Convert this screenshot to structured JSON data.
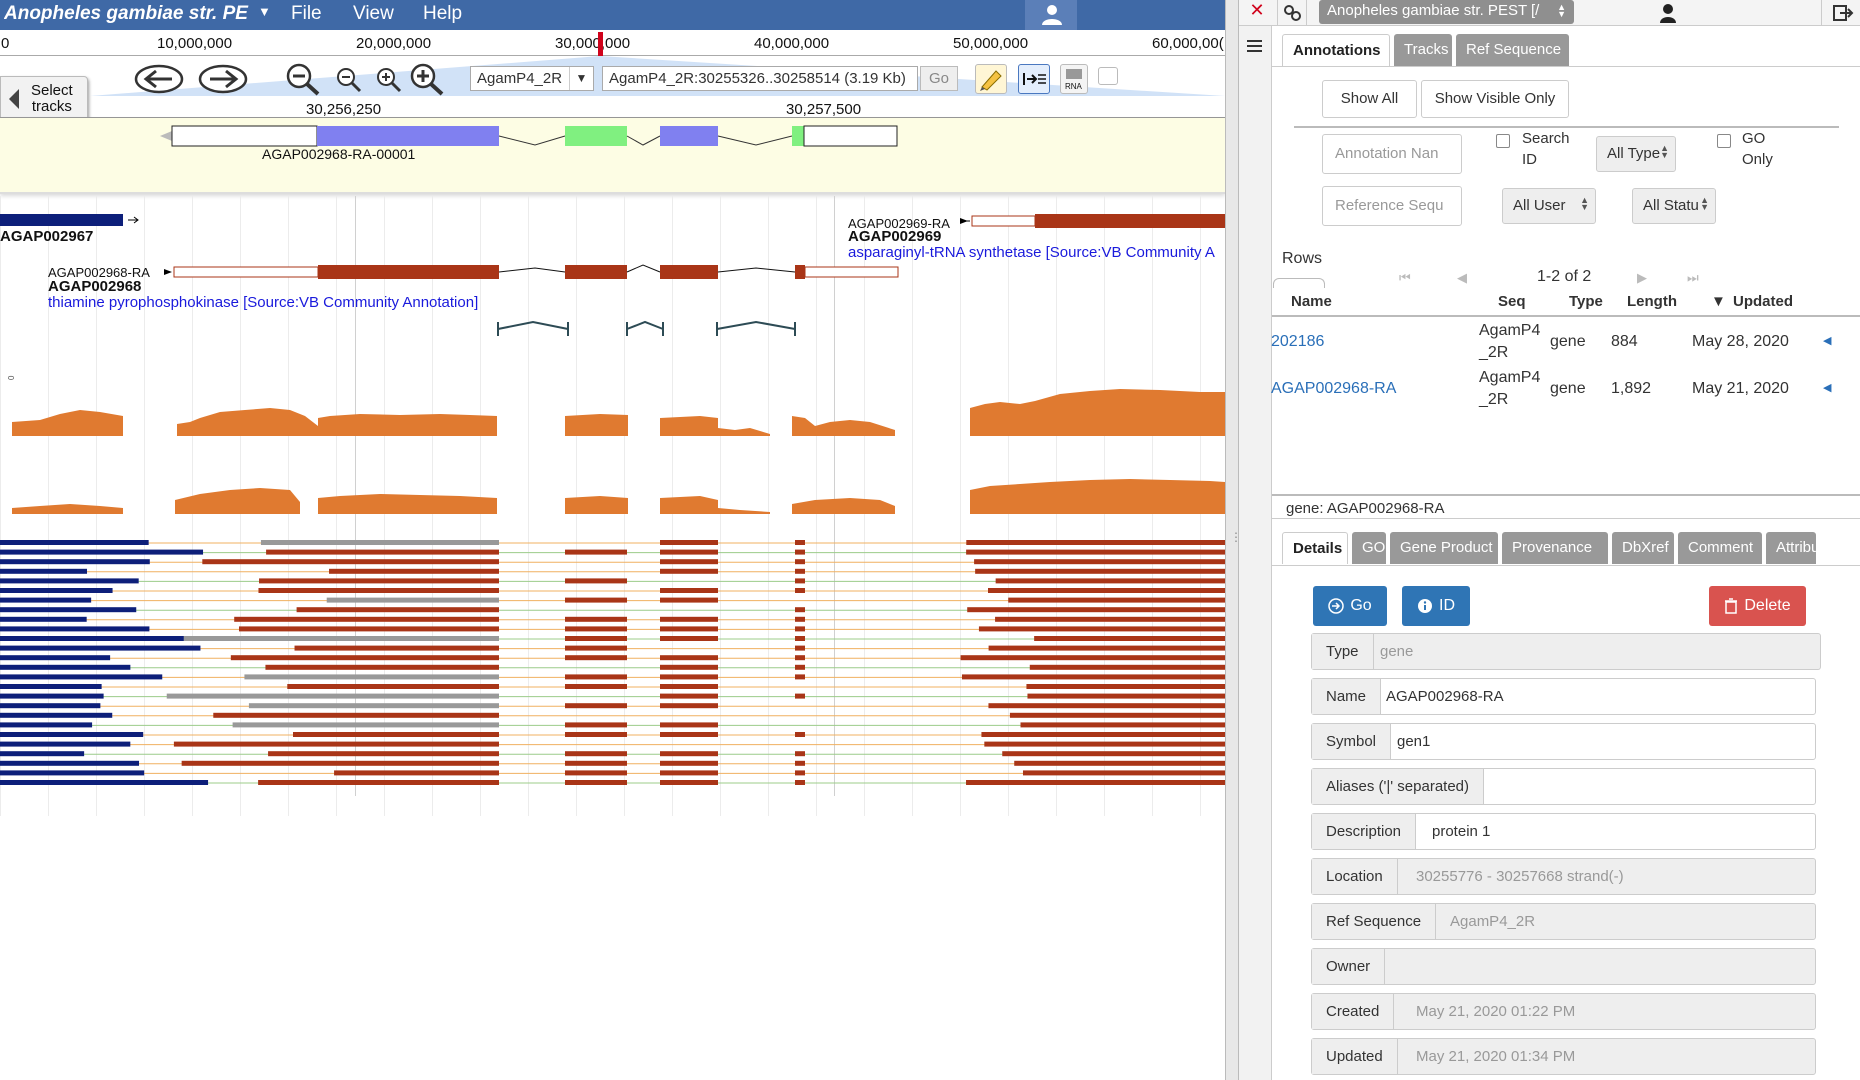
{
  "browser": {
    "organism": "Anopheles gambiae str. PE",
    "menus": [
      "File",
      "View",
      "Help"
    ],
    "overview_ticks": [
      "0",
      "10,000,000",
      "20,000,000",
      "30,000,000",
      "40,000,000",
      "50,000,000",
      "60,000,00("
    ],
    "ruler_ticks": [
      "30,256,250",
      "30,257,500"
    ],
    "refseq": "AgamP4_2R",
    "location": "AgamP4_2R:30255326..30258514 (3.19 Kb)",
    "go_label": "Go",
    "select_tracks": [
      "Select",
      "tracks"
    ],
    "user_annotation": "AGAP002968-RA-00001",
    "genes": [
      {
        "transcript": "AGAP002969-RA",
        "name": "AGAP002969",
        "description": "asparaginyl-tRNA synthetase [Source:VB Community A"
      },
      {
        "transcript": "AGAP002968-RA",
        "name": "AGAP002968",
        "description": "thiamine pyrophosphokinase [Source:VB Community Annotation]"
      },
      {
        "transcript": "",
        "name": "AGAP002967",
        "description": ""
      }
    ],
    "colors": {
      "menubar": "#3f69a6",
      "cds": "#a93517",
      "coverage": "#e07a30",
      "exon_blue": "#8080f0",
      "exon_green": "#80f080",
      "user_track_bg": "#fdfde4"
    }
  },
  "panel": {
    "organism_select": "Anopheles gambiae str. PEST [/",
    "tabs": [
      "Annotations",
      "Tracks",
      "Ref Sequence"
    ],
    "show_all": "Show All",
    "show_visible_only": "Show Visible Only",
    "annotation_name_placeholder": "Annotation Nan",
    "search_id_label": [
      "Search",
      "ID"
    ],
    "all_type": "All Type",
    "go_only_label": [
      "GO",
      "Only"
    ],
    "reference_seq_placeholder": "Reference Sequ",
    "all_user": "All User",
    "all_status": "All Statu",
    "rows_label": "Rows",
    "pagination": "1-2 of 2",
    "columns": [
      "Name",
      "Seq",
      "Type",
      "Length",
      "Updated"
    ],
    "rows": [
      {
        "name": "202186",
        "seq": [
          "AgamP4",
          "_2R"
        ],
        "type": "gene",
        "length": "884",
        "updated": "May 28, 2020"
      },
      {
        "name": "AGAP002968-RA",
        "seq": [
          "AgamP4",
          "_2R"
        ],
        "type": "gene",
        "length": "1,892",
        "updated": "May 21, 2020"
      }
    ],
    "selected_gene_label": "gene: AGAP002968-RA",
    "detail_tabs": [
      "Details",
      "GO",
      "Gene Product",
      "Provenance",
      "DbXref",
      "Comment",
      "Attribu"
    ],
    "actions": {
      "go": "Go",
      "id": "ID",
      "delete": "Delete"
    },
    "fields": [
      {
        "label": "Type",
        "value": "gene"
      },
      {
        "label": "Name",
        "value": "AGAP002968-RA"
      },
      {
        "label": "Symbol",
        "value": "gen1"
      },
      {
        "label": "Aliases ('|' separated)",
        "value": ""
      },
      {
        "label": "Description",
        "value": "protein 1"
      },
      {
        "label": "Location",
        "value": "30255776 - 30257668 strand(-)"
      },
      {
        "label": "Ref Sequence",
        "value": "AgamP4_2R"
      },
      {
        "label": "Owner",
        "value": ""
      },
      {
        "label": "Created",
        "value": "May 21, 2020 01:22 PM"
      },
      {
        "label": "Updated",
        "value": "May 21, 2020 01:34 PM"
      }
    ],
    "colors": {
      "blue_button": "#2f75b5",
      "delete_button": "#d9534f",
      "link": "#2a6fb8"
    }
  }
}
